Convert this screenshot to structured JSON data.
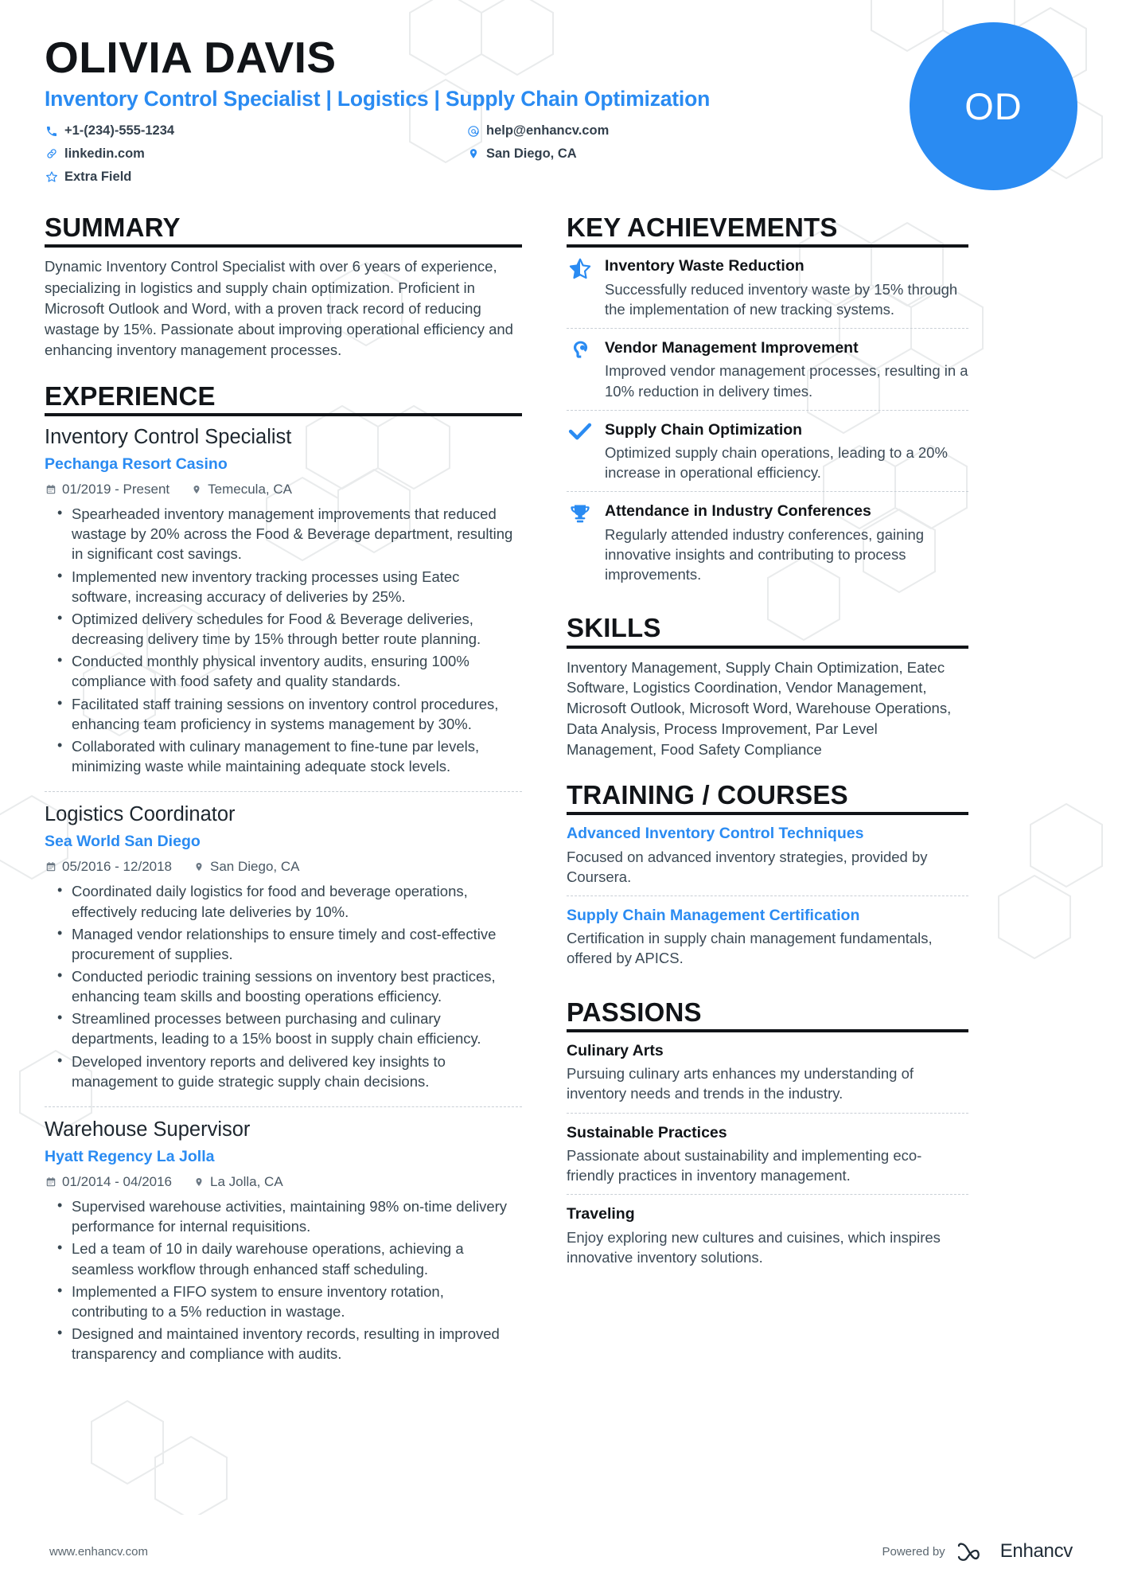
{
  "header": {
    "name": "OLIVIA DAVIS",
    "headline": "Inventory Control Specialist | Logistics | Supply Chain Optimization",
    "initials": "OD",
    "accent_color": "#2a8bf2",
    "contacts": [
      {
        "icon": "phone-icon",
        "text": "+1-(234)-555-1234"
      },
      {
        "icon": "email-icon",
        "text": "help@enhancv.com"
      },
      {
        "icon": "link-icon",
        "text": "linkedin.com"
      },
      {
        "icon": "location-icon",
        "text": "San Diego, CA"
      },
      {
        "icon": "star-outline-icon",
        "text": "Extra Field"
      }
    ]
  },
  "summary": {
    "title": "SUMMARY",
    "text": "Dynamic Inventory Control Specialist with over 6 years of experience, specializing in logistics and supply chain optimization. Proficient in Microsoft Outlook and Word, with a proven track record of reducing wastage by 15%. Passionate about improving operational efficiency and enhancing inventory management processes."
  },
  "experience": {
    "title": "EXPERIENCE",
    "jobs": [
      {
        "role": "Inventory Control Specialist",
        "company": "Pechanga Resort Casino",
        "dates": "01/2019 - Present",
        "location": "Temecula, CA",
        "bullets": [
          "Spearheaded inventory management improvements that reduced wastage by 20% across the Food & Beverage department, resulting in significant cost savings.",
          "Implemented new inventory tracking processes using Eatec software, increasing accuracy of deliveries by 25%.",
          "Optimized delivery schedules for Food & Beverage deliveries, decreasing delivery time by 15% through better route planning.",
          "Conducted monthly physical inventory audits, ensuring 100% compliance with food safety and quality standards.",
          "Facilitated staff training sessions on inventory control procedures, enhancing team proficiency in systems management by 30%.",
          "Collaborated with culinary management to fine-tune par levels, minimizing waste while maintaining adequate stock levels."
        ]
      },
      {
        "role": "Logistics Coordinator",
        "company": "Sea World San Diego",
        "dates": "05/2016 - 12/2018",
        "location": "San Diego, CA",
        "bullets": [
          "Coordinated daily logistics for food and beverage operations, effectively reducing late deliveries by 10%.",
          "Managed vendor relationships to ensure timely and cost-effective procurement of supplies.",
          "Conducted periodic training sessions on inventory best practices, enhancing team skills and boosting operations efficiency.",
          "Streamlined processes between purchasing and culinary departments, leading to a 15% boost in supply chain efficiency.",
          "Developed inventory reports and delivered key insights to management to guide strategic supply chain decisions."
        ]
      },
      {
        "role": "Warehouse Supervisor",
        "company": "Hyatt Regency La Jolla",
        "dates": "01/2014 - 04/2016",
        "location": "La Jolla, CA",
        "bullets": [
          "Supervised warehouse activities, maintaining 98% on-time delivery performance for internal requisitions.",
          "Led a team of 10 in daily warehouse operations, achieving a seamless workflow through enhanced staff scheduling.",
          "Implemented a FIFO system to ensure inventory rotation, contributing to a 5% reduction in wastage.",
          "Designed and maintained inventory records, resulting in improved transparency and compliance with audits."
        ]
      }
    ]
  },
  "key_achievements": {
    "title": "KEY ACHIEVEMENTS",
    "items": [
      {
        "icon": "star-half-icon",
        "title": "Inventory Waste Reduction",
        "desc": "Successfully reduced inventory waste by 15% through the implementation of new tracking systems."
      },
      {
        "icon": "head-idea-icon",
        "title": "Vendor Management Improvement",
        "desc": "Improved vendor management processes, resulting in a 10% reduction in delivery times."
      },
      {
        "icon": "check-icon",
        "title": "Supply Chain Optimization",
        "desc": "Optimized supply chain operations, leading to a 20% increase in operational efficiency."
      },
      {
        "icon": "trophy-icon",
        "title": "Attendance in Industry Conferences",
        "desc": "Regularly attended industry conferences, gaining innovative insights and contributing to process improvements."
      }
    ]
  },
  "skills": {
    "title": "SKILLS",
    "text": "Inventory Management, Supply Chain Optimization, Eatec Software, Logistics Coordination, Vendor Management, Microsoft Outlook, Microsoft Word, Warehouse Operations, Data Analysis, Process Improvement, Par Level Management, Food Safety Compliance"
  },
  "training": {
    "title": "TRAINING / COURSES",
    "items": [
      {
        "title": "Advanced Inventory Control Techniques",
        "desc": "Focused on advanced inventory strategies, provided by Coursera."
      },
      {
        "title": "Supply Chain Management Certification",
        "desc": "Certification in supply chain management fundamentals, offered by APICS."
      }
    ]
  },
  "passions": {
    "title": "PASSIONS",
    "items": [
      {
        "title": "Culinary Arts",
        "desc": "Pursuing culinary arts enhances my understanding of inventory needs and trends in the industry."
      },
      {
        "title": "Sustainable Practices",
        "desc": "Passionate about sustainability and implementing eco-friendly practices in inventory management."
      },
      {
        "title": "Traveling",
        "desc": "Enjoy exploring new cultures and cuisines, which inspires innovative inventory solutions."
      }
    ]
  },
  "footer": {
    "url": "www.enhancv.com",
    "powered_by": "Powered by",
    "brand": "Enhancv"
  }
}
